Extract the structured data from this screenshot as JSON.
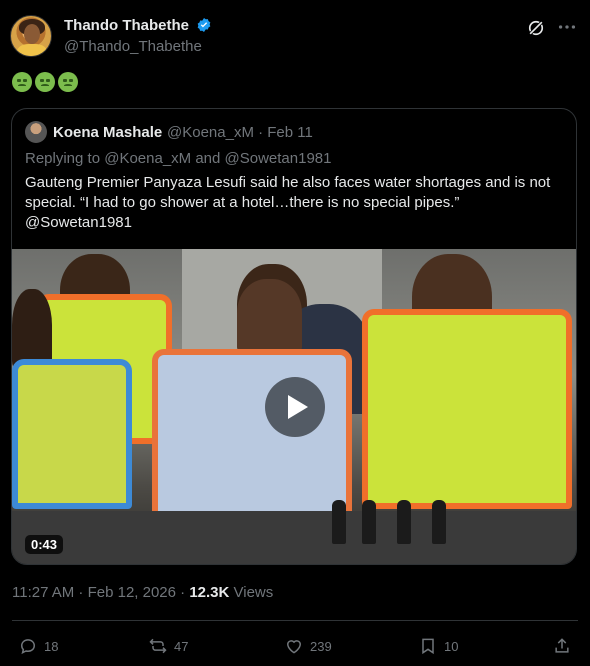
{
  "author": {
    "name": "Thando Thabethe",
    "handle": "@Thando_Thabethe",
    "verified": true
  },
  "post": {
    "emoji_count": 3,
    "emoji_name": "nauseated-face"
  },
  "quoted": {
    "name": "Koena Mashale",
    "handle_date": "@Koena_xM · Feb 11",
    "reply_prefix": "Replying to ",
    "reply_mentions": "@Koena_xM and @Sowetan1981",
    "text": "Gauteng Premier Panyaza Lesufi said he also faces water shortages and is not special. “I had to go shower at a hotel…there is no special pipes.” @Sowetan1981",
    "video_duration": "0:43"
  },
  "meta": {
    "time_date": "11:27 AM · Feb 12, 2026 · ",
    "views_count": "12.3K",
    "views_label": " Views"
  },
  "actions": {
    "replies": "18",
    "reposts": "47",
    "likes": "239",
    "bookmarks": "10"
  },
  "colors": {
    "background": "#000000",
    "text": "#e7e9ea",
    "muted": "#71767b",
    "border": "#2f3336",
    "verified": "#1d9bf0"
  }
}
